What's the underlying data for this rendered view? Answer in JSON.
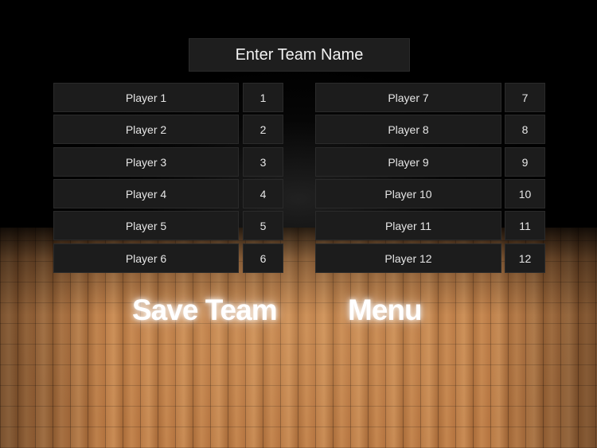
{
  "team_name": {
    "placeholder": "Enter Team Name"
  },
  "left_players": [
    {
      "name_placeholder": "Player 1",
      "number_placeholder": "1"
    },
    {
      "name_placeholder": "Player 2",
      "number_placeholder": "2"
    },
    {
      "name_placeholder": "Player 3",
      "number_placeholder": "3"
    },
    {
      "name_placeholder": "Player 4",
      "number_placeholder": "4"
    },
    {
      "name_placeholder": "Player 5",
      "number_placeholder": "5"
    },
    {
      "name_placeholder": "Player 6",
      "number_placeholder": "6"
    }
  ],
  "right_players": [
    {
      "name_placeholder": "Player 7",
      "number_placeholder": "7"
    },
    {
      "name_placeholder": "Player 8",
      "number_placeholder": "8"
    },
    {
      "name_placeholder": "Player 9",
      "number_placeholder": "9"
    },
    {
      "name_placeholder": "Player 10",
      "number_placeholder": "10"
    },
    {
      "name_placeholder": "Player 11",
      "number_placeholder": "11"
    },
    {
      "name_placeholder": "Player 12",
      "number_placeholder": "12"
    }
  ],
  "buttons": {
    "save_label": "Save Team",
    "menu_label": "Menu"
  },
  "colors": {
    "field_background": "#1c1c1c",
    "field_text": "#e6e6e6",
    "button_text": "#ffffff",
    "floor_wood": "#b8773f"
  }
}
